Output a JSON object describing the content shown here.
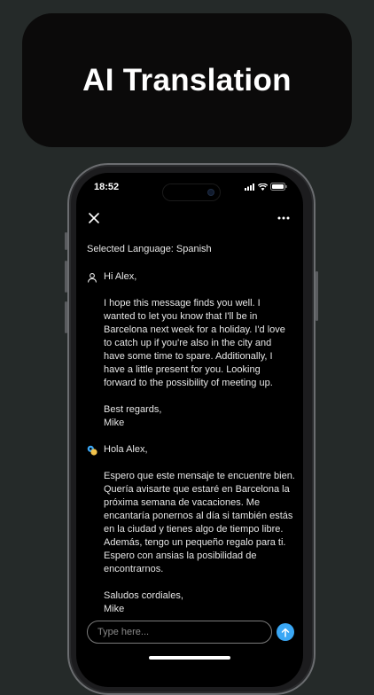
{
  "banner": {
    "title": "AI Translation"
  },
  "status_bar": {
    "time": "18:52",
    "icons": [
      "signal-icon",
      "wifi-icon",
      "battery-icon"
    ]
  },
  "header": {
    "close_icon": "close-icon",
    "more_icon": "more-icon"
  },
  "selected_language": "Selected Language: Spanish",
  "original_message": {
    "icon": "user-icon",
    "greeting": "Hi Alex,",
    "body_lines": [
      "I hope this message finds you well. I",
      "wanted to let you know that I'll be in",
      "Barcelona next week for a holiday. I'd love",
      "to catch up if you're also in the city and",
      "have some time to spare. Additionally, I",
      "have a little present for you. Looking",
      "forward to the possibility of meeting up."
    ],
    "closing": "Best regards,",
    "signature": "Mike"
  },
  "translated_message": {
    "icon": "ai-translate-icon",
    "greeting": "Hola Alex,",
    "body_lines": [
      "Espero que este mensaje te encuentre bien.",
      "Quería avisarte que estaré en Barcelona la",
      "próxima semana de vacaciones. Me",
      "encantaría ponernos al día si también estás",
      "en la ciudad y tienes algo de tiempo libre.",
      "Además, tengo un pequeño regalo para ti.",
      "Espero con ansias la posibilidad de",
      "encontrarnos."
    ],
    "closing": "Saludos cordiales,",
    "signature": "Mike"
  },
  "composer": {
    "placeholder": "Type here...",
    "value": ""
  },
  "colors": {
    "accent": "#3aa7f5",
    "background": "#252a29",
    "banner": "#0b0a0a",
    "screen": "#000000"
  }
}
